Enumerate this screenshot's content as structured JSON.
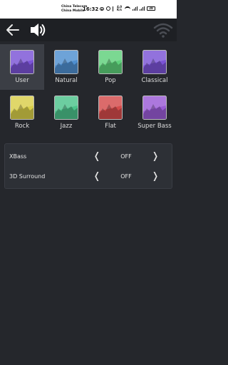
{
  "status_bar": {
    "carrier_1": "China Telecom",
    "carrier_2": "China Mobile",
    "time": "16:32",
    "speed": "4.0 K/s",
    "battery": "28"
  },
  "toolbar": {
    "back_icon": "arrow-left-icon",
    "speaker_icon": "speaker-icon",
    "wifi_icon": "wifi-icon"
  },
  "presets": [
    {
      "label": "User",
      "color": "#7b53d6",
      "selected": true
    },
    {
      "label": "Natural",
      "color": "#4f8fd0",
      "selected": false
    },
    {
      "label": "Pop",
      "color": "#5ed07a",
      "selected": false
    },
    {
      "label": "Classical",
      "color": "#7b53d6",
      "selected": false
    },
    {
      "label": "Rock",
      "color": "#d9cf4a",
      "selected": false
    },
    {
      "label": "Jazz",
      "color": "#4cc28b",
      "selected": false
    },
    {
      "label": "Flat",
      "color": "#d44b4b",
      "selected": false
    },
    {
      "label": "Super Bass",
      "color": "#9a5bd6",
      "selected": false
    }
  ],
  "settings": [
    {
      "label": "XBass",
      "value": "OFF",
      "prev": "❬",
      "next": "❭"
    },
    {
      "label": "3D Surround",
      "value": "OFF",
      "prev": "❬",
      "next": "❭"
    }
  ]
}
